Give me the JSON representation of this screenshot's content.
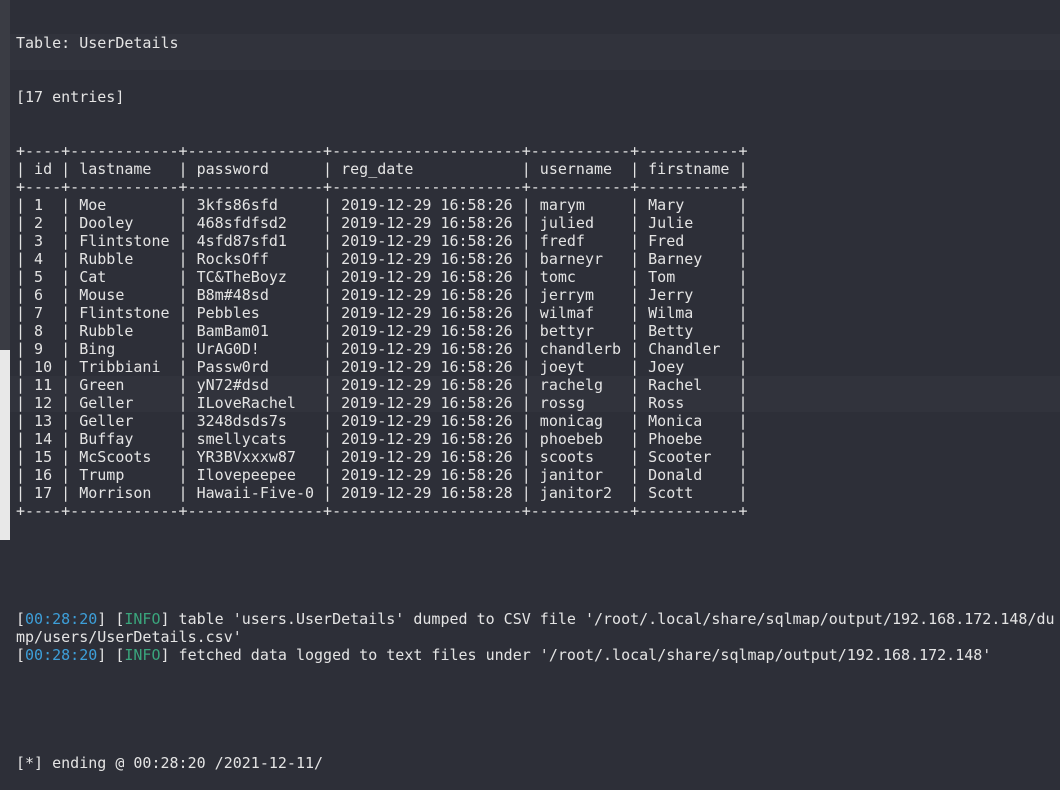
{
  "table_title": "Table: UserDetails",
  "entries": "[17 entries]",
  "columns": [
    "id",
    "lastname",
    "password",
    "reg_date",
    "username",
    "firstname"
  ],
  "rows": [
    [
      "1",
      "Moe",
      "3kfs86sfd",
      "2019-12-29 16:58:26",
      "marym",
      "Mary"
    ],
    [
      "2",
      "Dooley",
      "468sfdfsd2",
      "2019-12-29 16:58:26",
      "julied",
      "Julie"
    ],
    [
      "3",
      "Flintstone",
      "4sfd87sfd1",
      "2019-12-29 16:58:26",
      "fredf",
      "Fred"
    ],
    [
      "4",
      "Rubble",
      "RocksOff",
      "2019-12-29 16:58:26",
      "barneyr",
      "Barney"
    ],
    [
      "5",
      "Cat",
      "TC&TheBoyz",
      "2019-12-29 16:58:26",
      "tomc",
      "Tom"
    ],
    [
      "6",
      "Mouse",
      "B8m#48sd",
      "2019-12-29 16:58:26",
      "jerrym",
      "Jerry"
    ],
    [
      "7",
      "Flintstone",
      "Pebbles",
      "2019-12-29 16:58:26",
      "wilmaf",
      "Wilma"
    ],
    [
      "8",
      "Rubble",
      "BamBam01",
      "2019-12-29 16:58:26",
      "bettyr",
      "Betty"
    ],
    [
      "9",
      "Bing",
      "UrAG0D!",
      "2019-12-29 16:58:26",
      "chandlerb",
      "Chandler"
    ],
    [
      "10",
      "Tribbiani",
      "Passw0rd",
      "2019-12-29 16:58:26",
      "joeyt",
      "Joey"
    ],
    [
      "11",
      "Green",
      "yN72#dsd",
      "2019-12-29 16:58:26",
      "rachelg",
      "Rachel"
    ],
    [
      "12",
      "Geller",
      "ILoveRachel",
      "2019-12-29 16:58:26",
      "rossg",
      "Ross"
    ],
    [
      "13",
      "Geller",
      "3248dsds7s",
      "2019-12-29 16:58:26",
      "monicag",
      "Monica"
    ],
    [
      "14",
      "Buffay",
      "smellycats",
      "2019-12-29 16:58:26",
      "phoebeb",
      "Phoebe"
    ],
    [
      "15",
      "McScoots",
      "YR3BVxxxw87",
      "2019-12-29 16:58:26",
      "scoots",
      "Scooter"
    ],
    [
      "16",
      "Trump",
      "Ilovepeepee",
      "2019-12-29 16:58:26",
      "janitor",
      "Donald"
    ],
    [
      "17",
      "Morrison",
      "Hawaii-Five-0",
      "2019-12-29 16:58:28",
      "janitor2",
      "Scott"
    ]
  ],
  "log": [
    {
      "time": "00:28:20",
      "level": "INFO",
      "text": " table 'users.UserDetails' dumped to CSV file '/root/.local/share/sqlmap/output/192.168.172.148/du"
    },
    {
      "continuation": "mp/users/UserDetails.csv'"
    },
    {
      "time": "00:28:20",
      "level": "INFO",
      "text": " fetched data logged to text files under '/root/.local/share/sqlmap/output/192.168.172.148'"
    }
  ],
  "ending": "[*] ending @ 00:28:20 /2021-12-11/",
  "colors": {
    "background": "#2d2f38",
    "time": "#3d9fd9",
    "info": "#3aa57c",
    "text": "#e4e4e4"
  }
}
